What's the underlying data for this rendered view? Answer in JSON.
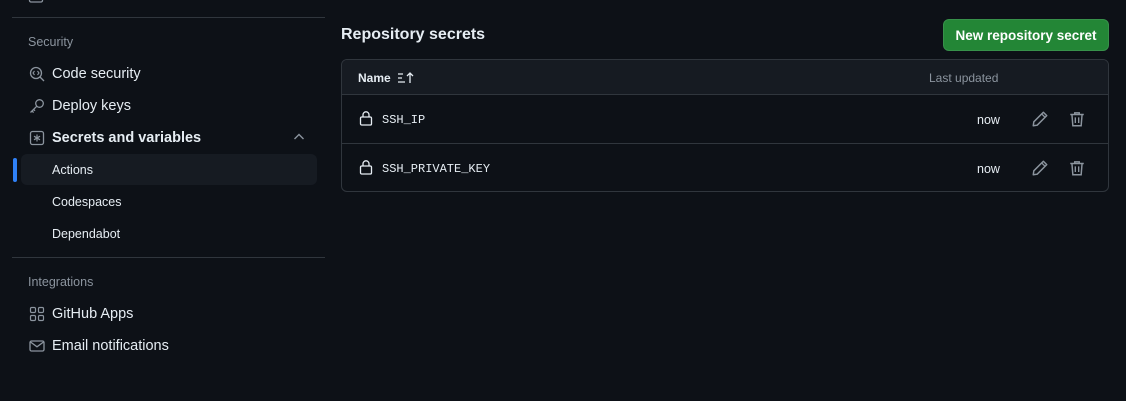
{
  "sidebar": {
    "security_title": "Security",
    "items": [
      {
        "label": "Code security",
        "icon": "codescan-icon"
      },
      {
        "label": "Deploy keys",
        "icon": "key-icon"
      },
      {
        "label": "Secrets and variables",
        "icon": "asterisk-icon"
      }
    ],
    "sub_items": [
      {
        "label": "Actions",
        "active": true
      },
      {
        "label": "Codespaces"
      },
      {
        "label": "Dependabot"
      }
    ],
    "integrations_title": "Integrations",
    "integration_items": [
      {
        "label": "GitHub Apps",
        "icon": "apps-icon"
      },
      {
        "label": "Email notifications",
        "icon": "mail-icon"
      }
    ]
  },
  "main": {
    "title": "Repository secrets",
    "new_button": "New repository secret",
    "table": {
      "col_name": "Name",
      "col_updated": "Last updated",
      "rows": [
        {
          "name": "SSH_IP",
          "updated": "now"
        },
        {
          "name": "SSH_PRIVATE_KEY",
          "updated": "now"
        }
      ]
    }
  },
  "colors": {
    "background": "#0d1117",
    "accent": "#2f81f7",
    "button": "#238636",
    "muted": "#8b949e"
  }
}
